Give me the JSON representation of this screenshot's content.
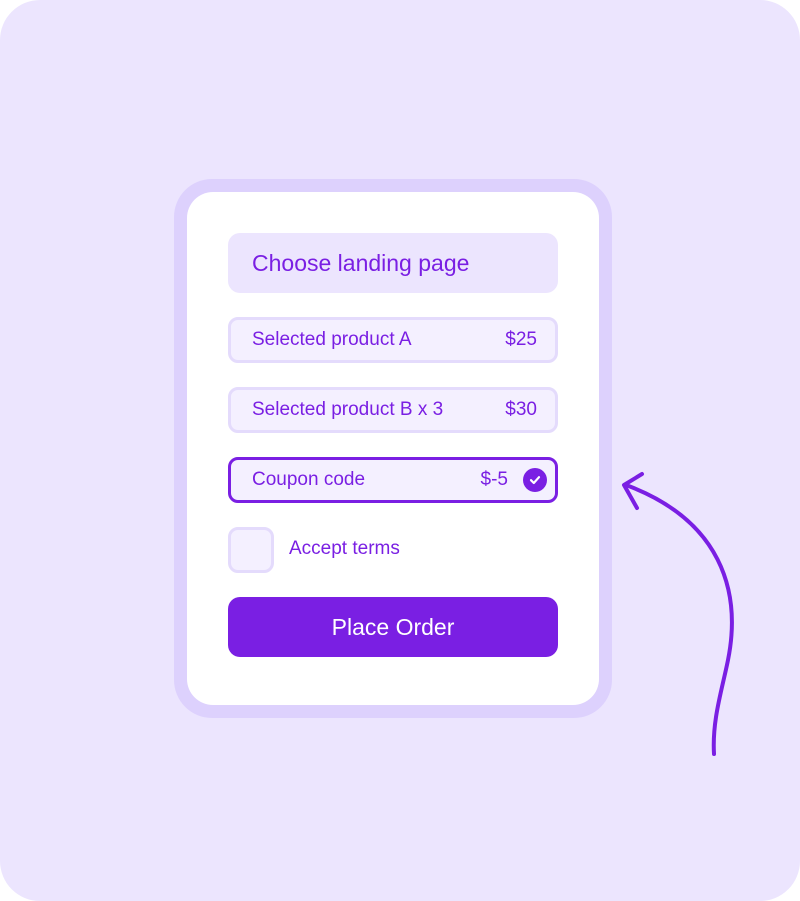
{
  "colors": {
    "background": "#ece5fe",
    "card_border": "#ddd1fd",
    "accent": "#7a1fe3",
    "field_background": "#f4f0ff"
  },
  "form": {
    "landing_page": {
      "label": "Choose landing page"
    },
    "line_items": [
      {
        "label": "Selected product A",
        "price": "$25"
      },
      {
        "label": "Selected product B x 3",
        "price": "$30"
      }
    ],
    "coupon": {
      "label": "Coupon code",
      "amount": "$-5",
      "applied": true,
      "icon": "check-circle-icon"
    },
    "terms": {
      "label": "Accept terms",
      "checked": false
    },
    "submit_label": "Place Order"
  },
  "decoration": {
    "arrow_icon": "curved-arrow-icon"
  }
}
